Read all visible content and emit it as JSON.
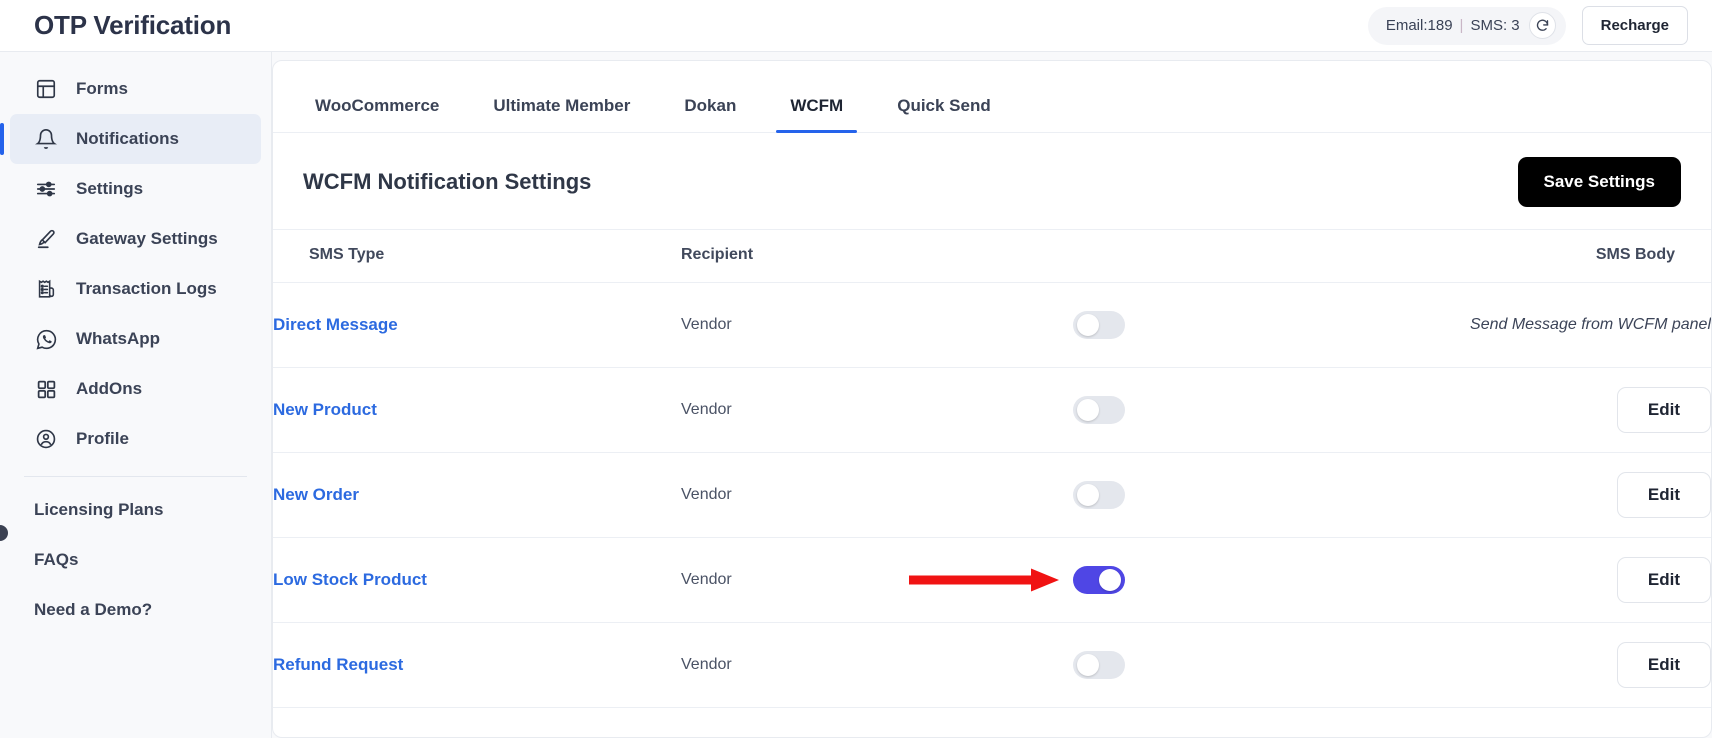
{
  "header": {
    "app_title": "OTP Verification",
    "credits": {
      "email_label": "Email:189",
      "separator": "|",
      "sms_label": "SMS: 3",
      "refresh_icon": "refresh-icon"
    },
    "recharge_label": "Recharge"
  },
  "sidebar": {
    "items": [
      {
        "label": "Forms",
        "icon": "forms-icon",
        "active": false
      },
      {
        "label": "Notifications",
        "icon": "bell-icon",
        "active": true
      },
      {
        "label": "Settings",
        "icon": "sliders-icon",
        "active": false
      },
      {
        "label": "Gateway Settings",
        "icon": "brush-icon",
        "active": false
      },
      {
        "label": "Transaction Logs",
        "icon": "receipt-icon",
        "active": false
      },
      {
        "label": "WhatsApp",
        "icon": "whatsapp-icon",
        "active": false
      },
      {
        "label": "AddOns",
        "icon": "grid-icon",
        "active": false
      },
      {
        "label": "Profile",
        "icon": "user-circle-icon",
        "active": false
      }
    ],
    "secondary_items": [
      {
        "label": "Licensing Plans"
      },
      {
        "label": "FAQs"
      },
      {
        "label": "Need a Demo?"
      }
    ]
  },
  "main": {
    "tabs": [
      {
        "label": "WooCommerce",
        "active": false
      },
      {
        "label": "Ultimate Member",
        "active": false
      },
      {
        "label": "Dokan",
        "active": false
      },
      {
        "label": "WCFM",
        "active": true
      },
      {
        "label": "Quick Send",
        "active": false
      }
    ],
    "panel_title": "WCFM Notification Settings",
    "save_label": "Save Settings",
    "table": {
      "columns": [
        "SMS Type",
        "Recipient",
        "",
        "SMS Body"
      ],
      "rows": [
        {
          "type": "Direct Message",
          "recipient": "Vendor",
          "enabled": false,
          "body_text": "Send Message from WCFM panel",
          "action": null,
          "annotated": false
        },
        {
          "type": "New Product",
          "recipient": "Vendor",
          "enabled": false,
          "body_text": null,
          "action": "Edit",
          "annotated": false
        },
        {
          "type": "New Order",
          "recipient": "Vendor",
          "enabled": false,
          "body_text": null,
          "action": "Edit",
          "annotated": false
        },
        {
          "type": "Low Stock Product",
          "recipient": "Vendor",
          "enabled": true,
          "body_text": null,
          "action": "Edit",
          "annotated": true
        },
        {
          "type": "Refund Request",
          "recipient": "Vendor",
          "enabled": false,
          "body_text": null,
          "action": "Edit",
          "annotated": false
        }
      ]
    }
  },
  "colors": {
    "accent_blue": "#2563eb",
    "link_blue": "#2c6ae0",
    "toggle_on": "#4f46e5",
    "toggle_off": "#e4e7ed",
    "annotation_red": "#f01313",
    "save_button_bg": "#000000",
    "sidebar_active_bg": "#e8edf6"
  }
}
